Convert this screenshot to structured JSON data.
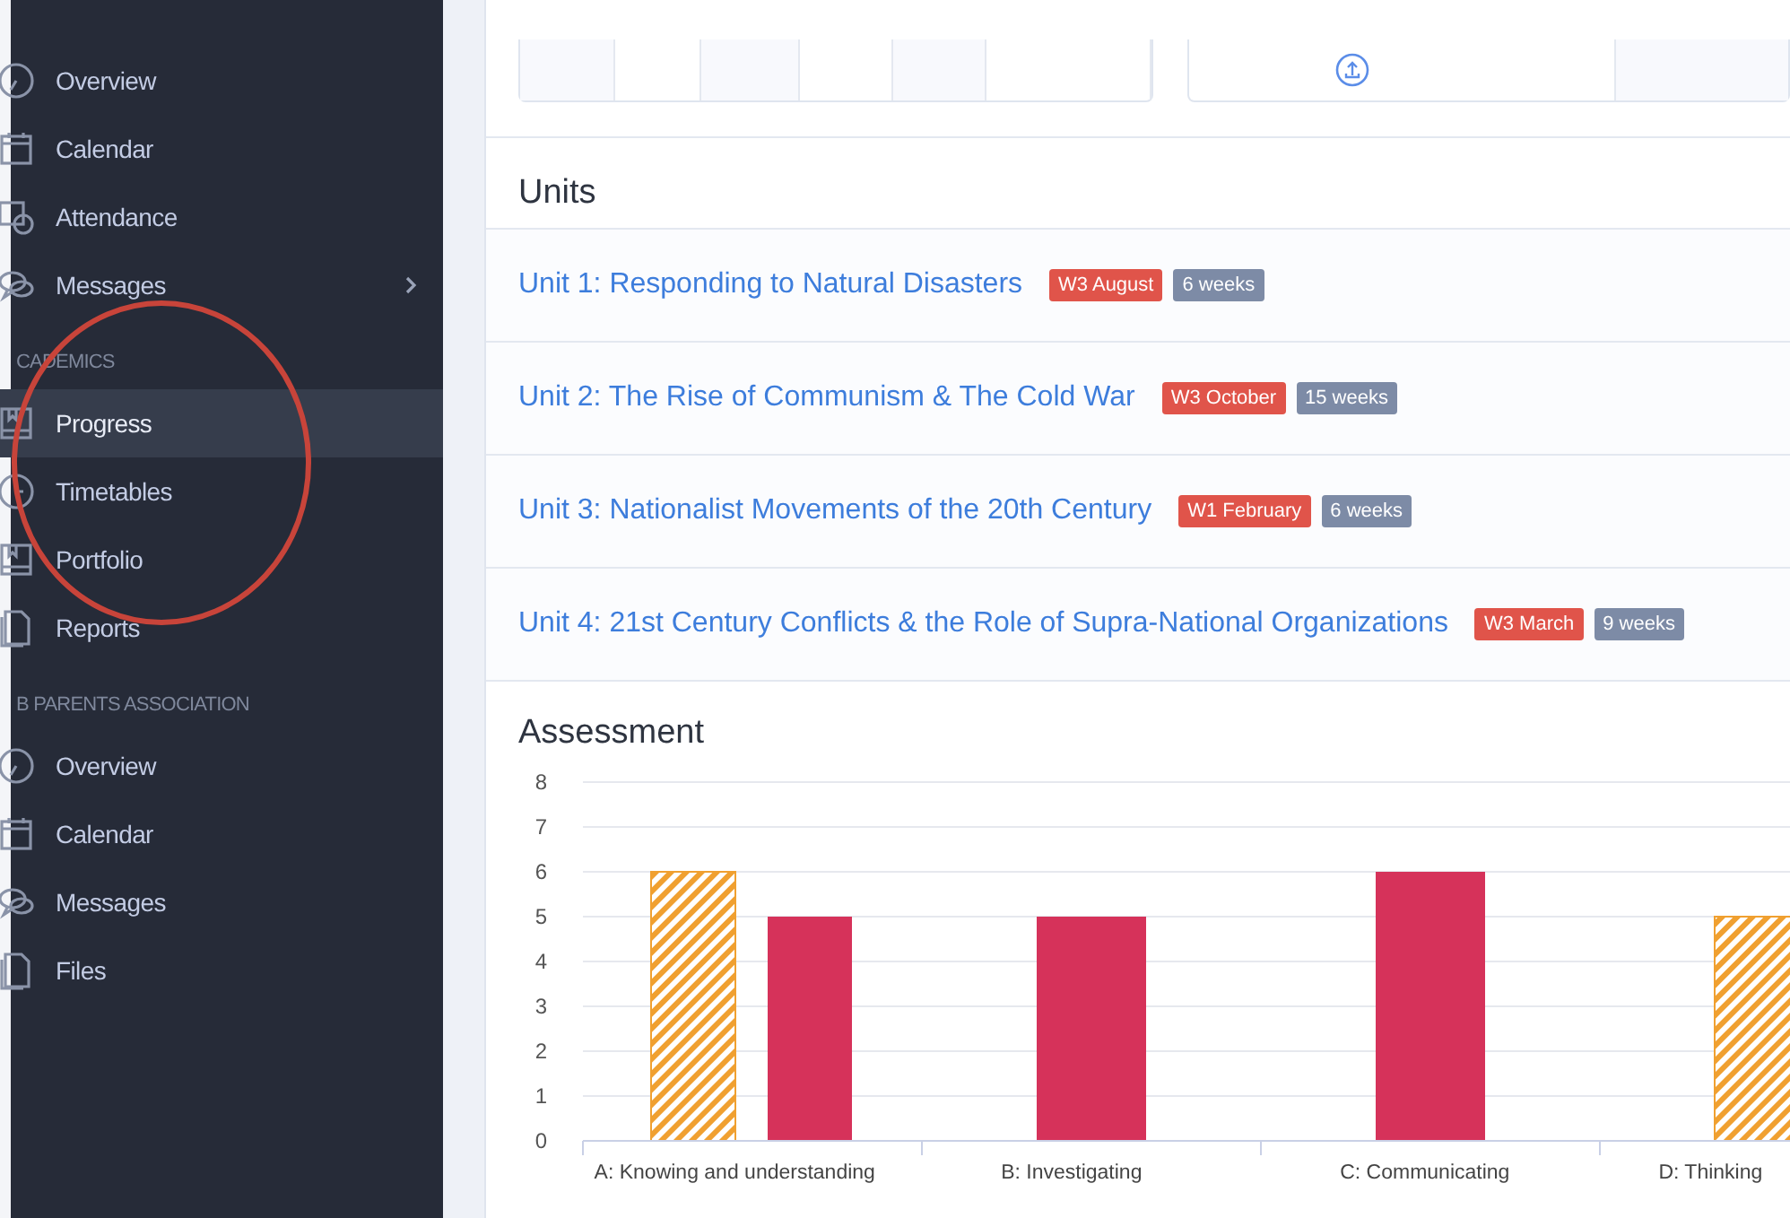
{
  "sidebar": {
    "sections": [
      {
        "items": [
          {
            "label": "Overview",
            "selected": false,
            "has_submenu": false
          },
          {
            "label": "Calendar",
            "selected": false,
            "has_submenu": false
          },
          {
            "label": "Attendance",
            "selected": false,
            "has_submenu": false
          },
          {
            "label": "Messages",
            "selected": false,
            "has_submenu": true
          }
        ]
      },
      {
        "heading": "CADEMICS",
        "items": [
          {
            "label": "Progress",
            "selected": true,
            "has_submenu": false
          },
          {
            "label": "Timetables",
            "selected": false,
            "has_submenu": false
          },
          {
            "label": "Portfolio",
            "selected": false,
            "has_submenu": false
          },
          {
            "label": "Reports",
            "selected": false,
            "has_submenu": false
          }
        ]
      },
      {
        "heading": "B PARENTS ASSOCIATION",
        "items": [
          {
            "label": "Overview",
            "selected": false,
            "has_submenu": false
          },
          {
            "label": "Calendar",
            "selected": false,
            "has_submenu": false
          },
          {
            "label": "Messages",
            "selected": false,
            "has_submenu": false
          },
          {
            "label": "Files",
            "selected": false,
            "has_submenu": false
          }
        ]
      }
    ]
  },
  "units": {
    "title": "Units",
    "rows": [
      {
        "title": "Unit 1: Responding to Natural Disasters",
        "badges": [
          {
            "text": "W3 August",
            "kind": "date"
          },
          {
            "text": "6 weeks",
            "kind": "duration"
          }
        ]
      },
      {
        "title": "Unit 2: The Rise of Communism & The Cold War",
        "badges": [
          {
            "text": "W3 October",
            "kind": "date"
          },
          {
            "text": "15 weeks",
            "kind": "duration"
          }
        ]
      },
      {
        "title": "Unit 3: Nationalist Movements of the 20th Century",
        "badges": [
          {
            "text": "W1 February",
            "kind": "date"
          },
          {
            "text": "6 weeks",
            "kind": "duration"
          }
        ]
      },
      {
        "title": "Unit 4: 21st Century Conflicts & the Role of Supra-National Organizations",
        "badges": [
          {
            "text": "W3 March",
            "kind": "date"
          },
          {
            "text": "9 weeks",
            "kind": "duration"
          }
        ]
      }
    ]
  },
  "assessment": {
    "title": "Assessment",
    "chart_data": {
      "type": "bar",
      "categories": [
        "A: Knowing and understanding",
        "B: Investigating",
        "C: Communicating",
        "D: Thinking"
      ],
      "series": [
        {
          "color": "#f0a030",
          "values": [
            6,
            null,
            null,
            5
          ]
        },
        {
          "color": "#d6325a",
          "values": [
            5,
            5,
            6,
            null
          ]
        }
      ],
      "grid": true,
      "ylim": [
        0,
        8
      ],
      "yticks": [
        0,
        1,
        2,
        3,
        4,
        5,
        6,
        7,
        8
      ]
    }
  }
}
